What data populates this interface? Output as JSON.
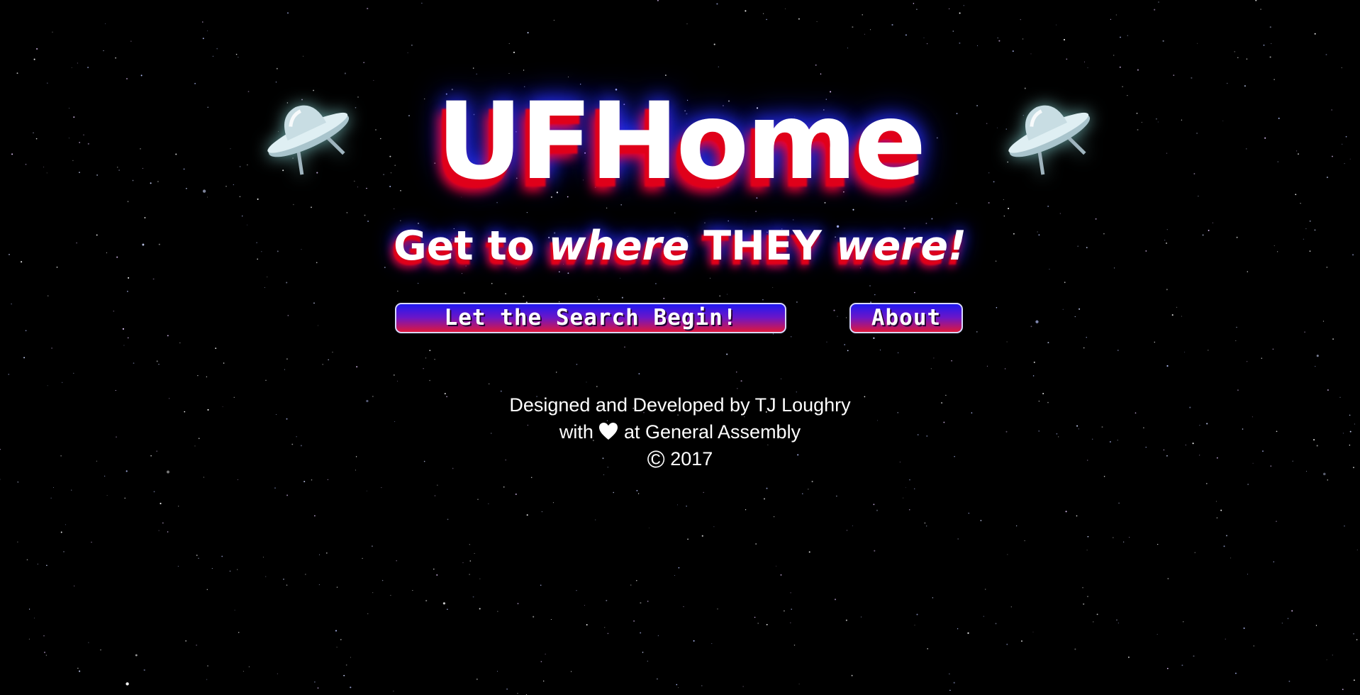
{
  "hero": {
    "title": "UFHome",
    "tagline_part1": "Get to ",
    "tagline_part2": "where",
    "tagline_part3": " THEY ",
    "tagline_part4": "were!"
  },
  "buttons": {
    "search_label": "Let the Search Begin!",
    "about_label": "About"
  },
  "credits": {
    "line1": "Designed and Developed by TJ Loughry",
    "line2_pre": "with ",
    "line2_post": " at General Assembly",
    "line3_year": " 2017"
  },
  "icons": {
    "ufo": "ufo-icon",
    "heart": "heart-icon",
    "copyright": "copyright-icon"
  },
  "colors": {
    "background": "#000000",
    "text": "#ffffff",
    "glow_red": "#ff0022",
    "glow_blue": "#2a33ff",
    "button_top": "#2019f0",
    "button_bottom": "#e0173a",
    "ufo_glow": "#8cdcdc"
  }
}
